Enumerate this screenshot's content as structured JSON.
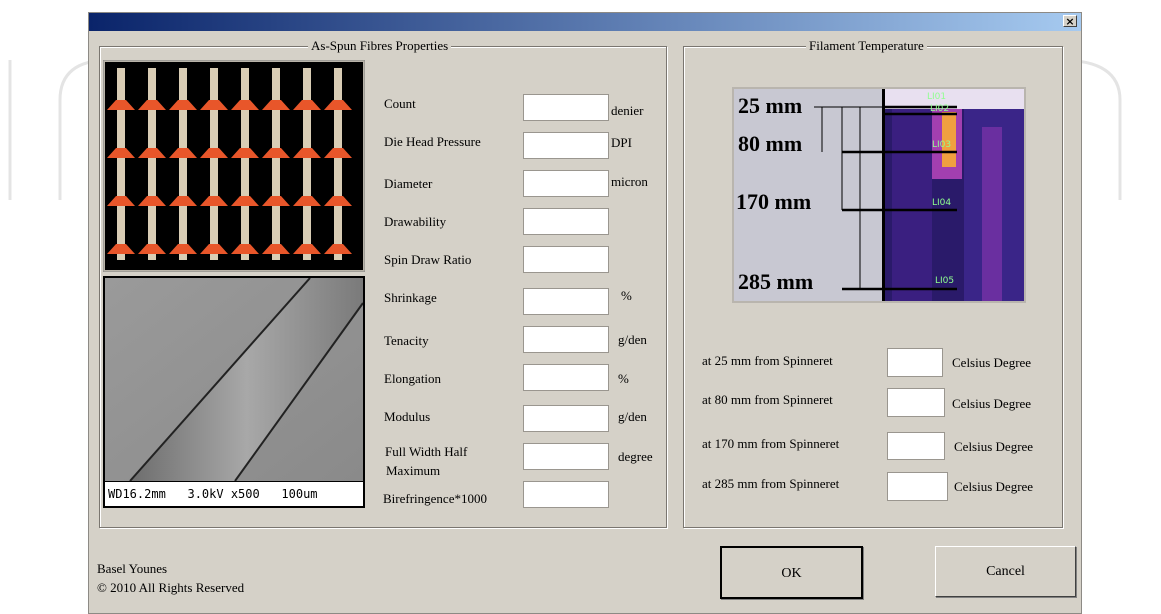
{
  "window": {
    "close_glyph": "×"
  },
  "fibre_group": {
    "title": "As-Spun Fibres Properties",
    "rows": [
      {
        "label": "Count",
        "unit": "denier",
        "value": ""
      },
      {
        "label": "Die Head Pressure",
        "unit": "DPI",
        "value": ""
      },
      {
        "label": "Diameter",
        "unit": "micron",
        "value": ""
      },
      {
        "label": "Drawability",
        "unit": "",
        "value": ""
      },
      {
        "label": "Spin Draw Ratio",
        "unit": "",
        "value": ""
      },
      {
        "label": "Shrinkage",
        "unit": "%",
        "value": ""
      },
      {
        "label": "Tenacity",
        "unit": "g/den",
        "value": ""
      },
      {
        "label": "Elongation",
        "unit": "%",
        "value": ""
      },
      {
        "label": "Modulus",
        "unit": "g/den",
        "value": ""
      },
      {
        "label": "Full Width Half",
        "label2": "Maximum",
        "unit": "degree",
        "value": ""
      },
      {
        "label": "Birefringence*1000",
        "unit": "",
        "value": ""
      }
    ],
    "sem_caption": "WD16.2mm   3.0kV x500   100um"
  },
  "temp_group": {
    "title": "Filament Temperature",
    "image_labels": [
      "25 mm",
      "80 mm",
      "170 mm",
      "285 mm"
    ],
    "thermal_tags": [
      "LI01",
      "LI02",
      "LI03",
      "LI04",
      "LI05"
    ],
    "rows": [
      {
        "label": "at 25 mm from Spinneret",
        "unit": "Celsius Degree",
        "value": ""
      },
      {
        "label": "at 80 mm from Spinneret",
        "unit": "Celsius Degree",
        "value": ""
      },
      {
        "label": "at 170 mm from Spinneret",
        "unit": "Celsius Degree",
        "value": ""
      },
      {
        "label": "at 285 mm from Spinneret",
        "unit": "Celsius Degree",
        "value": ""
      }
    ]
  },
  "footer": {
    "author": "Basel Younes",
    "copyright": "© 2010  All Rights Reserved"
  },
  "buttons": {
    "ok": "OK",
    "cancel": "Cancel"
  }
}
